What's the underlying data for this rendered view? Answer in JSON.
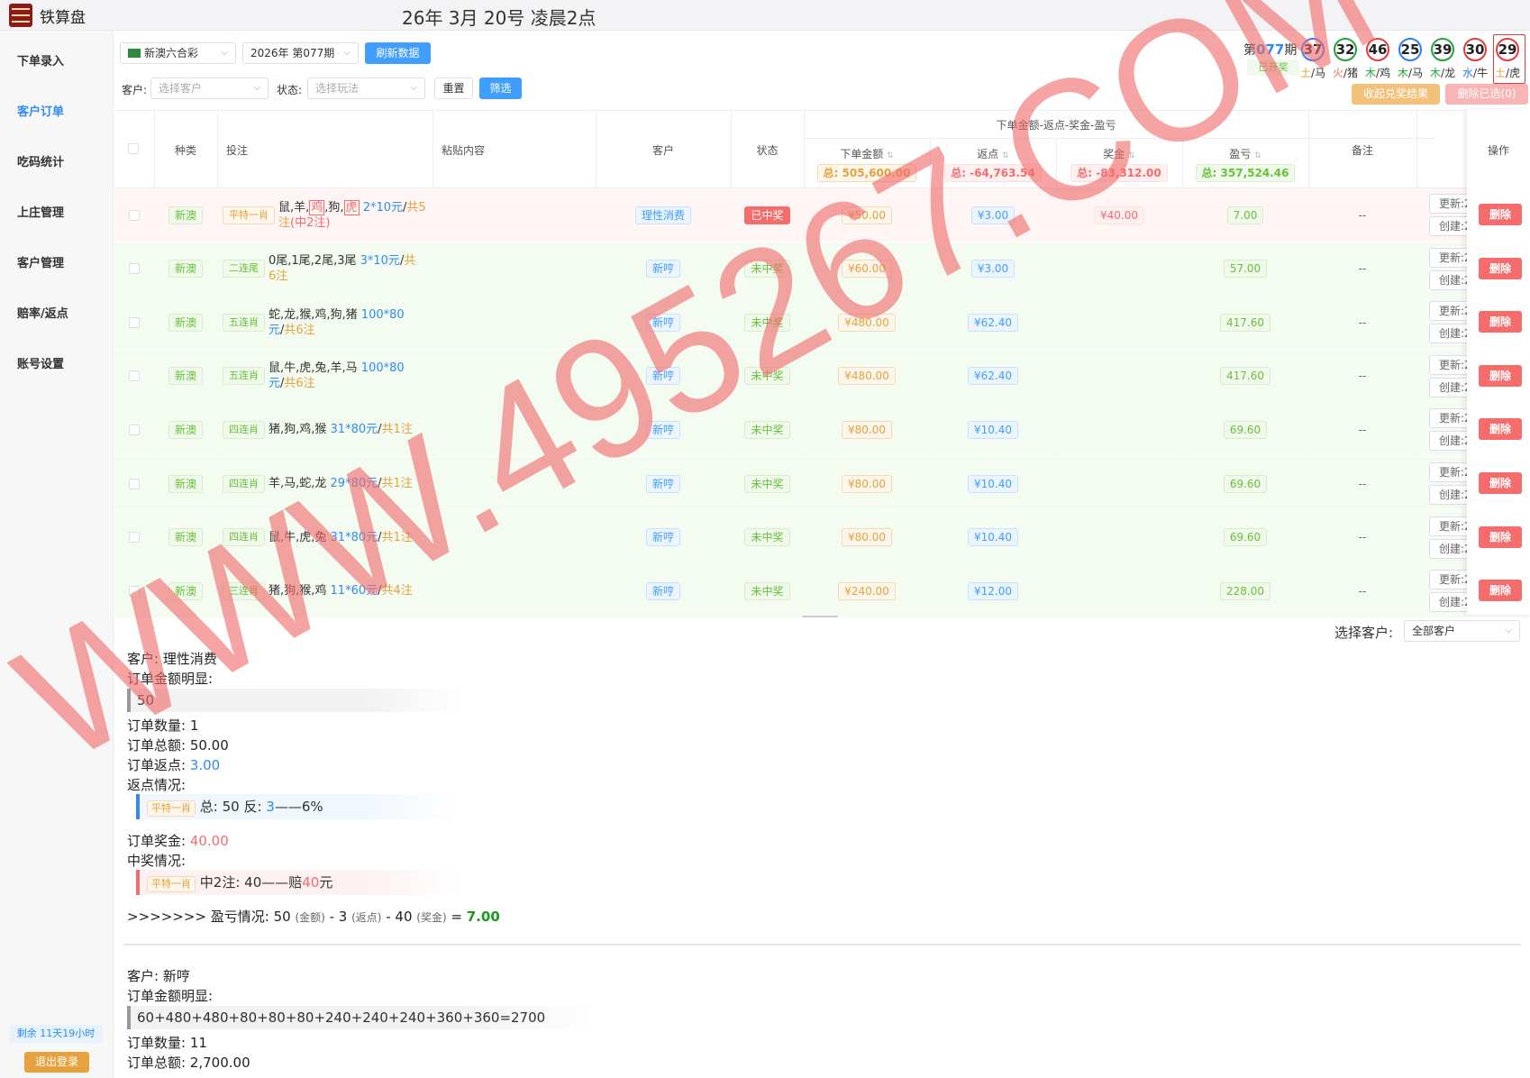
{
  "app": {
    "title": "铁算盘",
    "datetime": "26年 3月 20号 凌晨2点"
  },
  "sidebar": {
    "items": [
      "下单录入",
      "客户订单",
      "吃码统计",
      "上庄管理",
      "客户管理",
      "赔率/返点",
      "账号设置"
    ],
    "active": 1,
    "remaining": "剩余 11天19小时",
    "logout": "退出登录"
  },
  "filters": {
    "lottery": "新澳六合彩",
    "period": "2026年 第077期",
    "refresh": "刷新数据",
    "customer_label": "客户:",
    "customer_placeholder": "选择客户",
    "status_label": "状态:",
    "status_placeholder": "选择玩法",
    "reset": "重置",
    "filter": "筛选"
  },
  "draw": {
    "period_prefix": "第",
    "period_no": "077",
    "period_suffix": "期",
    "status": "已开奖",
    "balls": [
      {
        "num": "37",
        "color": "#2e7cf6",
        "element": "土",
        "element_color": "#e6a23c",
        "zodiac": "马"
      },
      {
        "num": "32",
        "color": "#22a33a",
        "element": "火",
        "element_color": "#f56c6c",
        "zodiac": "猪"
      },
      {
        "num": "46",
        "color": "#e23c3c",
        "element": "木",
        "element_color": "#22a33a",
        "zodiac": "鸡"
      },
      {
        "num": "25",
        "color": "#2e7cf6",
        "element": "木",
        "element_color": "#22a33a",
        "zodiac": "马"
      },
      {
        "num": "39",
        "color": "#22a33a",
        "element": "木",
        "element_color": "#22a33a",
        "zodiac": "龙"
      },
      {
        "num": "30",
        "color": "#e23c3c",
        "element": "水",
        "element_color": "#2e7cf6",
        "zodiac": "牛"
      },
      {
        "num": "29",
        "color": "#e23c3c",
        "element": "土",
        "element_color": "#e6a23c",
        "zodiac": "虎"
      }
    ],
    "collapse_btn": "收起兑奖结果",
    "delete_selected": "删除已选(0)"
  },
  "table": {
    "group_header": "下单金额-返点-奖金-盈亏",
    "headers": {
      "kind": "种类",
      "bet": "投注",
      "paste": "粘贴内容",
      "customer": "客户",
      "status": "状态",
      "amount": "下单金额",
      "rebate": "返点",
      "prize": "奖金",
      "profit": "盈亏",
      "remark": "备注",
      "op": "操作"
    },
    "totals": {
      "amount": "总: 505,600.00",
      "rebate": "总: -64,763.54",
      "prize": "总: -83,312.00",
      "profit": "总: 357,524.46"
    },
    "rows": [
      {
        "kind": "新澳",
        "type": "平特一肖",
        "type_color": "orange",
        "bet_pre": "鼠,羊,",
        "bet_c1": "鸡",
        "bet_mid": ",狗,",
        "bet_c2": "虎",
        "amt": " 2*10元",
        "sep": "/",
        "cnt": "共5注",
        "extra": "(中2注)",
        "customer": "理性消费",
        "status": "已中奖",
        "won": true,
        "amount": "¥50.00",
        "rebate": "¥3.00",
        "prize": "¥40.00",
        "profit": "7.00",
        "remark": "--",
        "upd": "更新:2",
        "crt": "创建:2",
        "del": "删除"
      },
      {
        "kind": "新澳",
        "type": "二连尾",
        "type_color": "green",
        "bet": "0尾,1尾,2尾,3尾",
        "amt": " 3*10元",
        "sep": "/",
        "cnt": "共6注",
        "customer": "新哼",
        "status": "未中奖",
        "won": false,
        "amount": "¥60.00",
        "rebate": "¥3.00",
        "prize": "",
        "profit": "57.00",
        "remark": "--",
        "upd": "更新:2",
        "crt": "创建:2",
        "del": "删除"
      },
      {
        "kind": "新澳",
        "type": "五连肖",
        "type_color": "green",
        "bet": "蛇,龙,猴,鸡,狗,猪",
        "amt": " 100*80元",
        "sep": "/",
        "cnt": "共6注",
        "customer": "新哼",
        "status": "未中奖",
        "won": false,
        "amount": "¥480.00",
        "rebate": "¥62.40",
        "prize": "",
        "profit": "417.60",
        "remark": "--",
        "upd": "更新:2",
        "crt": "创建:2",
        "del": "删除"
      },
      {
        "kind": "新澳",
        "type": "五连肖",
        "type_color": "green",
        "bet": "鼠,牛,虎,兔,羊,马",
        "amt": " 100*80元",
        "sep": "/",
        "cnt": "共6注",
        "customer": "新哼",
        "status": "未中奖",
        "won": false,
        "amount": "¥480.00",
        "rebate": "¥62.40",
        "prize": "",
        "profit": "417.60",
        "remark": "--",
        "upd": "更新:2",
        "crt": "创建:2",
        "del": "删除"
      },
      {
        "kind": "新澳",
        "type": "四连肖",
        "type_color": "green",
        "bet": "猪,狗,鸡,猴",
        "amt": " 31*80元",
        "sep": "/",
        "cnt": "共1注",
        "customer": "新哼",
        "status": "未中奖",
        "won": false,
        "amount": "¥80.00",
        "rebate": "¥10.40",
        "prize": "",
        "profit": "69.60",
        "remark": "--",
        "upd": "更新:2",
        "crt": "创建:2",
        "del": "删除"
      },
      {
        "kind": "新澳",
        "type": "四连肖",
        "type_color": "green",
        "bet": "羊,马,蛇,龙",
        "amt": " 29*80元",
        "sep": "/",
        "cnt": "共1注",
        "customer": "新哼",
        "status": "未中奖",
        "won": false,
        "amount": "¥80.00",
        "rebate": "¥10.40",
        "prize": "",
        "profit": "69.60",
        "remark": "--",
        "upd": "更新:2",
        "crt": "创建:2",
        "del": "删除"
      },
      {
        "kind": "新澳",
        "type": "四连肖",
        "type_color": "green",
        "bet": "鼠,牛,虎,兔",
        "amt": " 31*80元",
        "sep": "/",
        "cnt": "共1注",
        "customer": "新哼",
        "status": "未中奖",
        "won": false,
        "amount": "¥80.00",
        "rebate": "¥10.40",
        "prize": "",
        "profit": "69.60",
        "remark": "--",
        "upd": "更新:2",
        "crt": "创建:2",
        "del": "删除"
      },
      {
        "kind": "新澳",
        "type": "三连肖",
        "type_color": "green",
        "bet": "猪,狗,猴,鸡",
        "amt": " 11*60元",
        "sep": "/",
        "cnt": "共4注",
        "customer": "新哼",
        "status": "未中奖",
        "won": false,
        "amount": "¥240.00",
        "rebate": "¥12.00",
        "prize": "",
        "profit": "228.00",
        "remark": "--",
        "upd": "更新:2",
        "crt": "创建:2",
        "del": "删除"
      }
    ]
  },
  "customer_select": {
    "label": "选择客户:",
    "value": "全部客户"
  },
  "summary1": {
    "customer": "客户:  理性消费",
    "detail_label": "订单金额明显:",
    "detail": "50",
    "count": "订单数量:  1",
    "total": "订单总额:  50.00",
    "rebate_label": "订单返点:  ",
    "rebate": "3.00",
    "rebate_info_label": "返点情况:",
    "rebate_tag": "平特一肖",
    "rebate_line_pre": "总: 50  反: ",
    "rebate_line_val": "3",
    "rebate_line_post": "——6%",
    "prize_label": "订单奖金:  ",
    "prize": "40.00",
    "win_label": "中奖情况:",
    "win_tag": "平特一肖",
    "win_line_pre": "中2注: 40——赔",
    "win_line_val": "40",
    "win_line_post": "元",
    "pl_pre": ">>>>>>> 盈亏情况:  50 ",
    "pl_amt": "(金额)",
    "pl_mid1": " - 3 ",
    "pl_reb": "(返点)",
    "pl_mid2": " - 40 ",
    "pl_prize": "(奖金)",
    "pl_eq": " = ",
    "pl_val": "7.00"
  },
  "summary2": {
    "customer": "客户:  新哼",
    "detail_label": "订单金额明显:",
    "detail": "60+480+480+80+80+80+240+240+240+360+360=2700",
    "count": "订单数量:  11",
    "total": "订单总额:  2,700.00"
  },
  "watermark": "WWW.495267.COM"
}
